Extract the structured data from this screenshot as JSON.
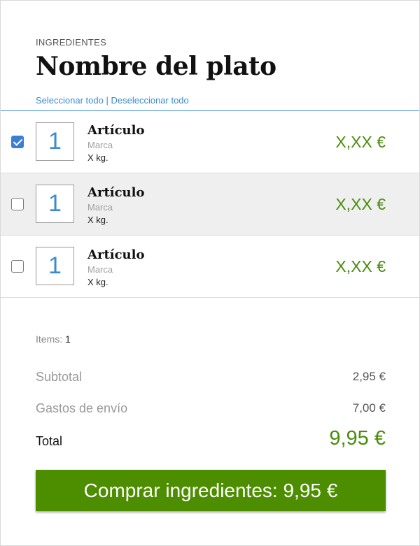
{
  "header": {
    "section_label": "INGREDIENTES",
    "dish_title": "Nombre del plato"
  },
  "selection": {
    "select_all": "Seleccionar todo",
    "separator": "|",
    "deselect_all": "Deseleccionar todo"
  },
  "items": [
    {
      "checked": true,
      "quantity": "1",
      "name": "Artículo",
      "brand": "Marca",
      "weight": "X kg.",
      "price": "X,XX €"
    },
    {
      "checked": false,
      "quantity": "1",
      "name": "Artículo",
      "brand": "Marca",
      "weight": "X kg.",
      "price": "X,XX €"
    },
    {
      "checked": false,
      "quantity": "1",
      "name": "Artículo",
      "brand": "Marca",
      "weight": "X kg.",
      "price": "X,XX €"
    }
  ],
  "summary": {
    "items_label": "Items:",
    "items_count": "1",
    "subtotal_label": "Subtotal",
    "subtotal_value": "2,95 €",
    "shipping_label": "Gastos de envío",
    "shipping_value": "7,00 €",
    "total_label": "Total",
    "total_value": "9,95 €"
  },
  "buy_button": {
    "label": "Comprar ingredientes: 9,95 €"
  },
  "colors": {
    "accent_blue": "#3a8bcf",
    "price_green": "#4a8c0c",
    "button_green": "#4d8e00",
    "alt_row": "#efefef"
  }
}
